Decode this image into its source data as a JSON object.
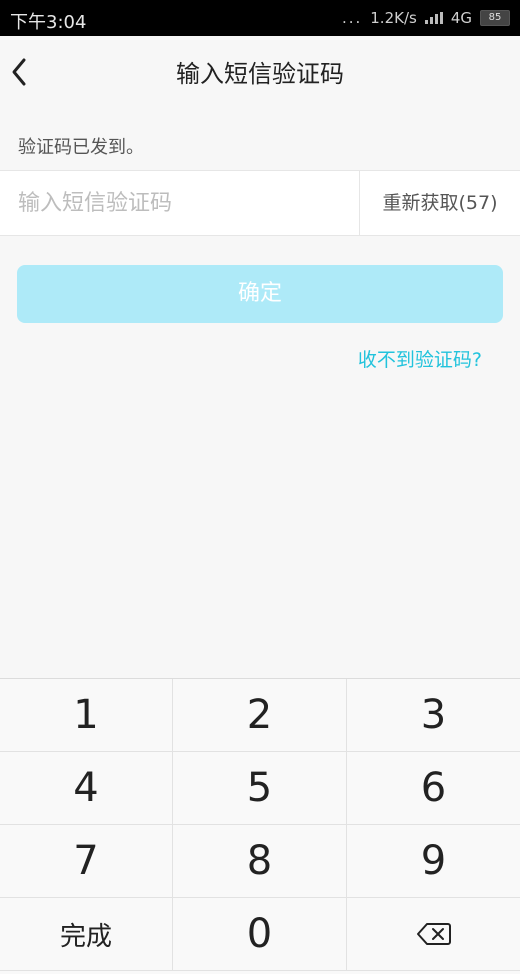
{
  "status_bar": {
    "time": "下午3:04",
    "dots": "...",
    "network_speed": "1.2K/s",
    "network_type": "4G",
    "battery": "85"
  },
  "header": {
    "back_icon": "chevron-left-icon",
    "title": "输入短信验证码"
  },
  "sent_hint": "验证码已发到。",
  "code_input": {
    "placeholder": "输入短信验证码",
    "value": ""
  },
  "resend_button": "重新获取(57)",
  "confirm_button": "确定",
  "no_code_link": "收不到验证码?",
  "keypad": {
    "keys": [
      "1",
      "2",
      "3",
      "4",
      "5",
      "6",
      "7",
      "8",
      "9"
    ],
    "done": "完成",
    "zero": "0",
    "backspace_icon": "backspace-icon"
  },
  "colors": {
    "accent": "#22c3dc",
    "confirm_disabled": "#aeeaf8",
    "background": "#f7f7f7"
  }
}
